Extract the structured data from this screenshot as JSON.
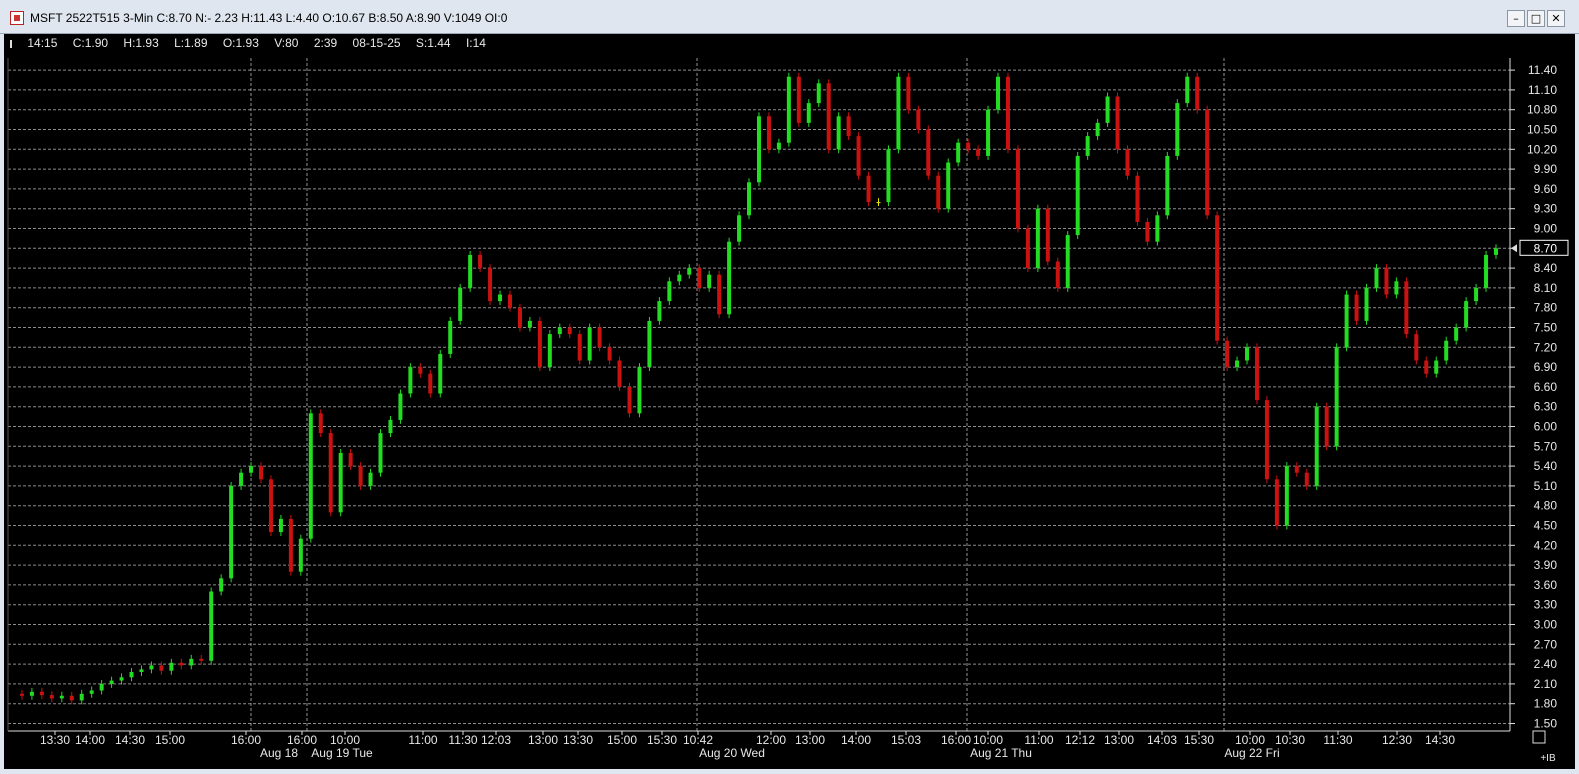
{
  "window": {
    "title": "MSFT 2522T515 3-Min C:8.70 N:- 2.23 H:11.43 L:4.40 O:10.67 B:8.50 A:8.90 V:1049 OI:0",
    "min_glyph": "–",
    "max_glyph": "□",
    "close_glyph": "✕",
    "icon": "chart-app-icon"
  },
  "info_bar": {
    "time": "14:15",
    "close": "C:1.90",
    "high": "H:1.93",
    "low": "L:1.89",
    "open": "O:1.93",
    "volume": "V:80",
    "elapsed": "2:39",
    "date": "08-15-25",
    "s": "S:1.44",
    "i": "I:14"
  },
  "corner": {
    "indicator": "+IB"
  },
  "colors": {
    "up": "#22dd22",
    "down": "#cc1111",
    "doji": "#e8e800",
    "grid": "#bbbbbb",
    "background": "#000000",
    "last_price_box": "#ffffff"
  },
  "chart_data": {
    "type": "candlestick",
    "symbol": "MSFT 2522T515",
    "interval": "3-Min",
    "ylim": [
      1.5,
      11.5
    ],
    "yticks": [
      "1.50",
      "1.80",
      "2.10",
      "2.40",
      "2.70",
      "3.00",
      "3.30",
      "3.60",
      "3.90",
      "4.20",
      "4.50",
      "4.80",
      "5.10",
      "5.40",
      "5.70",
      "6.00",
      "6.30",
      "6.60",
      "6.90",
      "7.20",
      "7.50",
      "7.80",
      "8.10",
      "8.40",
      "8.70",
      "9.00",
      "9.30",
      "9.60",
      "9.90",
      "10.20",
      "10.50",
      "10.80",
      "11.10",
      "11.40"
    ],
    "last_price": "8.70",
    "grid": true,
    "day_labels": [
      "Aug 18",
      "Aug 19 Tue",
      "Aug 20 Wed",
      "Aug 21 Thu",
      "Aug 22 Fri"
    ],
    "time_labels": [
      "13:30",
      "14:00",
      "14:30",
      "15:00",
      "16:00",
      "16:00",
      "10:00",
      "11:00",
      "11:30",
      "12:03",
      "13:00",
      "13:30",
      "15:00",
      "15:30",
      "10:42",
      "12:00",
      "13:00",
      "14:00",
      "15:03",
      "16:00",
      "10:00",
      "11:00",
      "12:12",
      "13:00",
      "14:03",
      "15:30",
      "10:00",
      "10:30",
      "11:30",
      "12:30",
      "14:30"
    ],
    "session_breaks": [
      "Aug 18 16:00",
      "Aug 19 16:00",
      "Aug 21 open",
      "Aug 22 open"
    ],
    "price_path": [
      1.95,
      1.92,
      1.98,
      1.93,
      1.88,
      1.92,
      1.85,
      1.95,
      2.0,
      2.1,
      2.15,
      2.2,
      2.28,
      2.32,
      2.38,
      2.3,
      2.42,
      2.38,
      2.48,
      2.45,
      3.5,
      3.7,
      5.1,
      5.3,
      5.4,
      5.2,
      4.4,
      4.6,
      3.8,
      4.3,
      6.2,
      5.9,
      4.7,
      5.6,
      5.4,
      5.1,
      5.3,
      5.9,
      6.1,
      6.5,
      6.9,
      6.8,
      6.5,
      7.1,
      7.6,
      8.1,
      8.6,
      8.4,
      7.9,
      8.0,
      7.8,
      7.5,
      7.6,
      6.9,
      7.4,
      7.5,
      7.4,
      7.0,
      7.5,
      7.2,
      7.0,
      6.6,
      6.2,
      6.9,
      7.6,
      7.9,
      8.2,
      8.3,
      8.4,
      8.1,
      8.3,
      7.7,
      8.8,
      9.2,
      9.7,
      10.7,
      10.2,
      10.3,
      11.3,
      10.6,
      10.9,
      11.2,
      10.2,
      10.7,
      10.4,
      9.8,
      9.4,
      9.4,
      10.2,
      11.3,
      10.8,
      10.5,
      9.8,
      9.3,
      10.0,
      10.3,
      10.2,
      10.1,
      10.8,
      11.3,
      10.2,
      9.0,
      8.4,
      9.3,
      8.5,
      8.1,
      8.9,
      10.1,
      10.4,
      10.6,
      11.0,
      10.2,
      9.8,
      9.1,
      8.8,
      9.2,
      10.1,
      10.9,
      11.3,
      10.8,
      9.2,
      7.3,
      6.9,
      7.0,
      7.2,
      6.4,
      5.2,
      4.5,
      5.4,
      5.3,
      5.1,
      6.3,
      5.7,
      7.2,
      8.0,
      7.6,
      8.1,
      8.4,
      8.0,
      8.2,
      7.4,
      7.0,
      6.8,
      7.0,
      7.3,
      7.5,
      7.9,
      8.1,
      8.6,
      8.7
    ]
  }
}
